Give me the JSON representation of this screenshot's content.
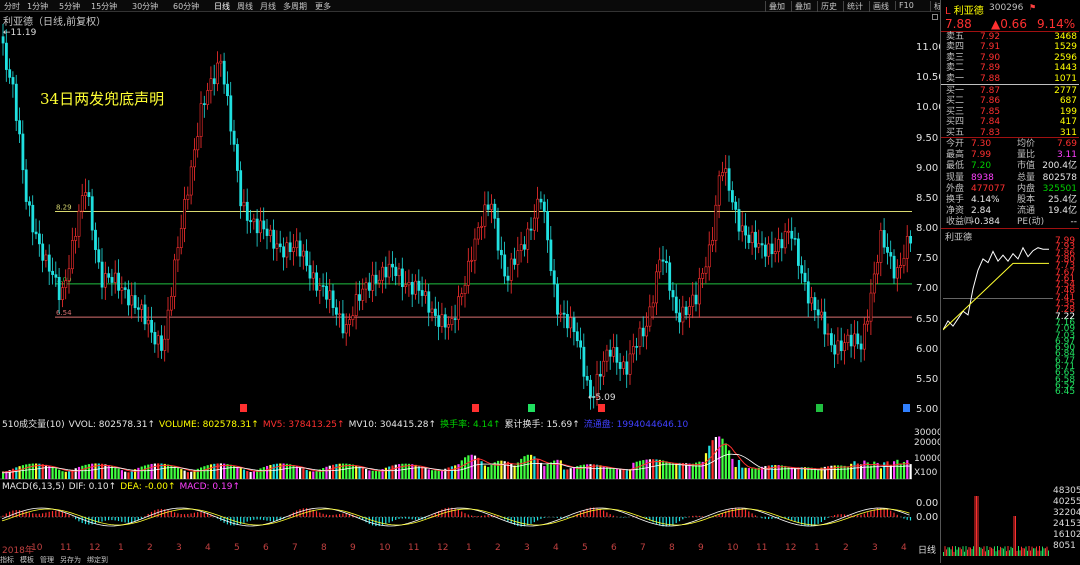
{
  "toolbar": {
    "items": [
      "分时",
      "1分钟",
      "5分钟",
      "15分钟",
      "30分钟",
      "60分钟",
      "日线",
      "周线",
      "月线",
      "多周期",
      "更多"
    ],
    "active": "日线",
    "right_items": [
      "叠加",
      "叠加",
      "历史",
      "统计",
      "画线",
      "F10",
      "标记",
      "+自选",
      "返回"
    ]
  },
  "chart": {
    "title": "利亚德（日线,前复权）",
    "annotation": "34日两发兜底声明",
    "high_label": "11.19",
    "low_label": "5.09",
    "price_axis": [
      "11.00",
      "10.50",
      "10.00",
      "9.50",
      "9.00",
      "8.50",
      "8.00",
      "7.50",
      "7.00",
      "6.50",
      "6.00",
      "5.50",
      "5.00"
    ],
    "hlines": [
      {
        "label": "8.29",
        "value": 8.29,
        "color": "#d8d870"
      },
      {
        "label": "7.09",
        "value": 7.09,
        "color": "#20c040"
      },
      {
        "label": "6.54",
        "value": 6.54,
        "color": "#d87070"
      }
    ]
  },
  "chart_data": {
    "type": "candlestick",
    "title": "利亚德（日线,前复权）",
    "ylim": [
      4.9,
      11.4
    ],
    "high": 11.19,
    "low": 5.09,
    "lines": [
      8.29,
      7.09,
      6.54
    ],
    "months": [
      "2018年",
      "10",
      "11",
      "12",
      "1",
      "2",
      "3",
      "4",
      "5",
      "6",
      "7",
      "8",
      "9",
      "10",
      "11",
      "12",
      "1",
      "2",
      "3",
      "4",
      "5",
      "6",
      "7",
      "8",
      "9",
      "10",
      "11",
      "12",
      "1",
      "2",
      "3",
      "4"
    ]
  },
  "volume": {
    "label": "510成交量(10)",
    "vvol": "VVOL: 802578.31↑",
    "volume": "VOLUME: 802578.31↑",
    "mv5": "MV5: 378413.25↑",
    "mv10": "MV10: 304415.28↑",
    "turnover": "换手率: 4.14↑",
    "cum_turnover": "累计换手: 15.69↑",
    "float": "流通盘: 1994044646.10",
    "axis": [
      "30000",
      "20000",
      "10000",
      "X100"
    ]
  },
  "macd": {
    "label": "MACD(6,13,5)",
    "dif": "DIF: 0.10↑",
    "dea": "DEA: -0.00↑",
    "macd": "MACD: 0.19↑",
    "axis": [
      "0.00",
      "0.00"
    ]
  },
  "bottom_tabs": [
    "指标",
    "模板",
    "管理",
    "另存为",
    "绑定到"
  ],
  "period_label": "日线",
  "quote": {
    "name": "利亚德",
    "code": "300296",
    "price": "7.88",
    "change": "▲0.66",
    "pct": "9.14%",
    "asks": [
      {
        "label": "卖五",
        "price": "7.92",
        "vol": "3468"
      },
      {
        "label": "卖四",
        "price": "7.91",
        "vol": "1529"
      },
      {
        "label": "卖三",
        "price": "7.90",
        "vol": "2596"
      },
      {
        "label": "卖二",
        "price": "7.89",
        "vol": "1443"
      },
      {
        "label": "卖一",
        "price": "7.88",
        "vol": "1071"
      }
    ],
    "bids": [
      {
        "label": "买一",
        "price": "7.87",
        "vol": "2777"
      },
      {
        "label": "买二",
        "price": "7.86",
        "vol": "687"
      },
      {
        "label": "买三",
        "price": "7.85",
        "vol": "199"
      },
      {
        "label": "买四",
        "price": "7.84",
        "vol": "417"
      },
      {
        "label": "买五",
        "price": "7.83",
        "vol": "311"
      }
    ],
    "stats": [
      {
        "a": "今开",
        "b": "7.30",
        "bc": "red",
        "c": "均价",
        "d": "7.69",
        "dc": "red"
      },
      {
        "a": "最高",
        "b": "7.99",
        "bc": "red",
        "c": "量比",
        "d": "3.11",
        "dc": "mag"
      },
      {
        "a": "最低",
        "b": "7.20",
        "bc": "grn",
        "c": "市值",
        "d": "200.4亿",
        "dc": "wht"
      },
      {
        "a": "现量",
        "b": "8938",
        "bc": "mag",
        "c": "总量",
        "d": "802578",
        "dc": "wht"
      },
      {
        "a": "外盘",
        "b": "477077",
        "bc": "red",
        "c": "内盘",
        "d": "325501",
        "dc": "grn"
      },
      {
        "a": "换手",
        "b": "4.14%",
        "bc": "wht",
        "c": "股本",
        "d": "25.4亿",
        "dc": "wht"
      },
      {
        "a": "净资",
        "b": "2.84",
        "bc": "wht",
        "c": "流通",
        "d": "19.4亿",
        "dc": "wht"
      },
      {
        "a": "收益㈣",
        "b": "-0.384",
        "bc": "wht",
        "c": "PE(动)",
        "d": "--",
        "dc": "wht"
      }
    ],
    "mini_title": "利亚德",
    "mini_axis": [
      "7.99",
      "7.93",
      "7.86",
      "7.80",
      "7.73",
      "7.67",
      "7.61",
      "7.54",
      "7.48",
      "7.41",
      "7.35",
      "7.28",
      "7.22",
      "7.16",
      "7.09",
      "7.03",
      "6.97",
      "6.90",
      "6.84",
      "6.77",
      "6.71",
      "6.65",
      "6.58",
      "6.52",
      "6.45"
    ],
    "mini_vol_axis": [
      "48305",
      "40255",
      "32204",
      "24153",
      "16102",
      "8051"
    ]
  }
}
